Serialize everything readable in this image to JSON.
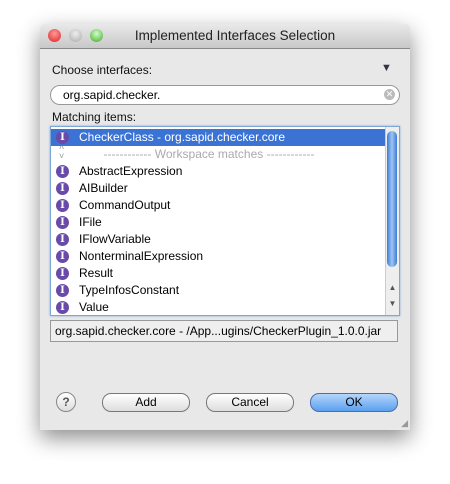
{
  "window": {
    "title": "Implemented Interfaces Selection"
  },
  "choose_label": "Choose interfaces:",
  "menu_icon": "triangle-down-icon",
  "search": {
    "value": "org.sapid.checker.",
    "clear_icon": "⊗"
  },
  "matching_label": "Matching items:",
  "items": [
    {
      "label": "CheckerClass - org.sapid.checker.core",
      "selected": true
    },
    {
      "label": "------------ Workspace matches ------------",
      "separator": true
    },
    {
      "label": "AbstractExpression"
    },
    {
      "label": "AIBuilder"
    },
    {
      "label": "CommandOutput"
    },
    {
      "label": "IFile"
    },
    {
      "label": "IFlowVariable"
    },
    {
      "label": "NonterminalExpression"
    },
    {
      "label": "Result"
    },
    {
      "label": "TypeInfosConstant"
    },
    {
      "label": "Value"
    }
  ],
  "interface_glyph": "I",
  "status": "org.sapid.checker.core - /App...ugins/CheckerPlugin_1.0.0.jar",
  "buttons": {
    "help": "?",
    "add": "Add",
    "cancel": "Cancel",
    "ok": "OK"
  }
}
